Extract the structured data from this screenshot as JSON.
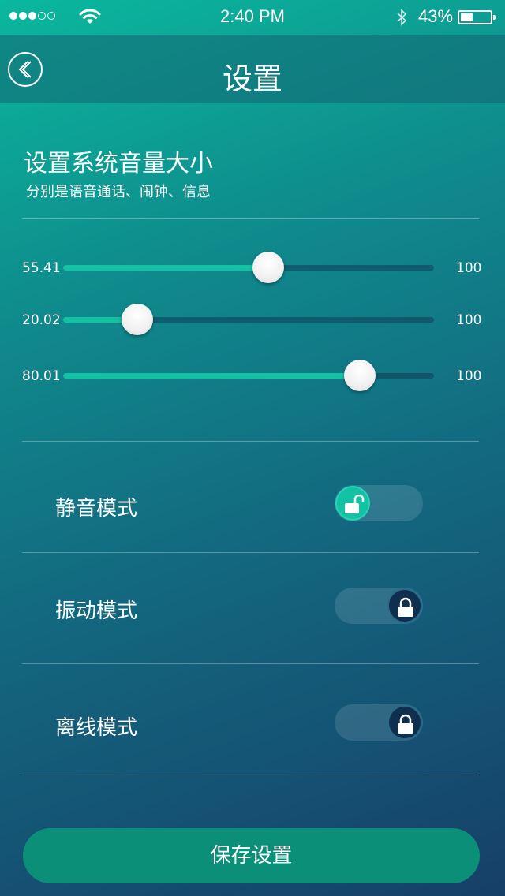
{
  "status_bar": {
    "signal_dots_filled": 3,
    "signal_dots_total": 5,
    "time": "2:40 PM",
    "battery_percent_text": "43%",
    "battery_level": 0.43
  },
  "navbar": {
    "title": "设置",
    "back_icon": "chevron-left-icon"
  },
  "volume_section": {
    "title": "设置系统音量大小",
    "subtitle": "分别是语音通话、闹钟、信息",
    "sliders": [
      {
        "value_text": "55.41",
        "value": 55.41,
        "max_text": "100",
        "max": 100
      },
      {
        "value_text": "20.02",
        "value": 20.02,
        "max_text": "100",
        "max": 100
      },
      {
        "value_text": "80.01",
        "value": 80.01,
        "max_text": "100",
        "max": 100
      }
    ]
  },
  "modes": [
    {
      "label": "静音模式",
      "on": true,
      "icon": "unlock-icon"
    },
    {
      "label": "振动模式",
      "on": false,
      "icon": "lock-icon"
    },
    {
      "label": "离线模式",
      "on": false,
      "icon": "lock-icon"
    }
  ],
  "save_button": {
    "label": "保存设置"
  },
  "colors": {
    "accent": "#12c2a2",
    "save_button": "#0b8f78",
    "knob_off": "#0f2f4f"
  }
}
